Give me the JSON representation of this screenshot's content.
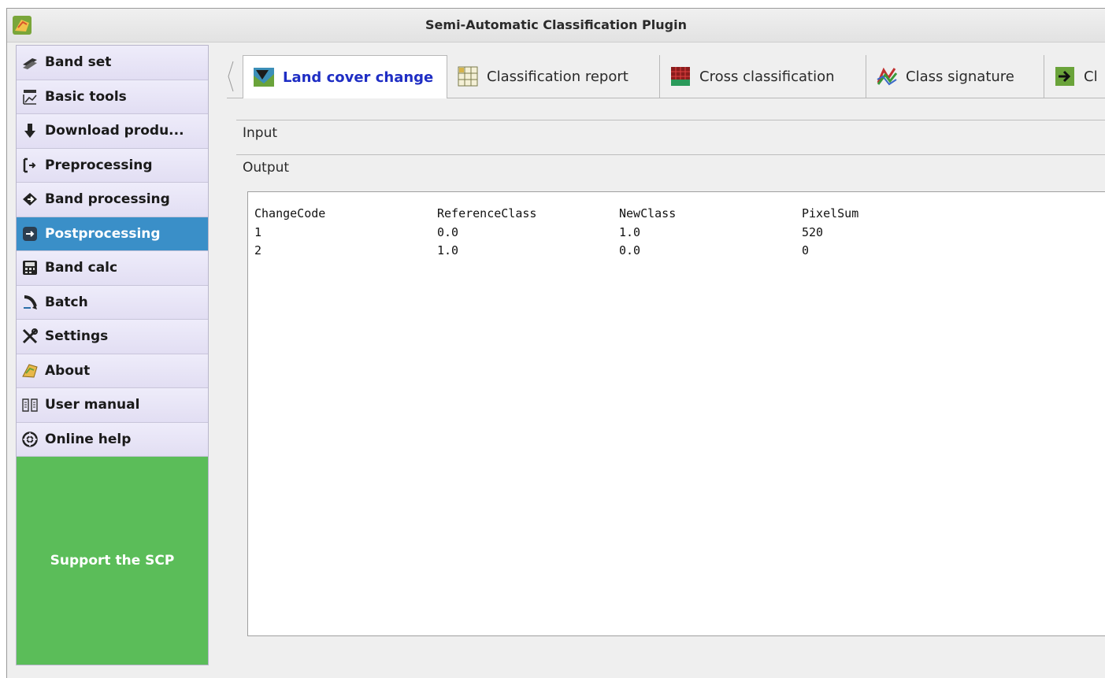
{
  "window": {
    "title": "Semi-Automatic Classification Plugin"
  },
  "sidebar": {
    "items": [
      {
        "label": "Band set",
        "icon": "band-set-icon"
      },
      {
        "label": "Basic tools",
        "icon": "basic-tools-icon"
      },
      {
        "label": "Download produ...",
        "icon": "download-icon"
      },
      {
        "label": "Preprocessing",
        "icon": "preprocessing-icon"
      },
      {
        "label": "Band processing",
        "icon": "band-processing-icon"
      },
      {
        "label": "Postprocessing",
        "icon": "postprocessing-icon"
      },
      {
        "label": "Band calc",
        "icon": "calculator-icon"
      },
      {
        "label": "Batch",
        "icon": "batch-icon"
      },
      {
        "label": "Settings",
        "icon": "settings-icon"
      },
      {
        "label": "About",
        "icon": "about-icon"
      },
      {
        "label": "User manual",
        "icon": "manual-icon"
      },
      {
        "label": "Online help",
        "icon": "help-icon"
      }
    ],
    "active": "Postprocessing",
    "support_label": "Support the SCP"
  },
  "tabs": [
    {
      "label": "Land cover change",
      "icon": "land-cover-change-icon"
    },
    {
      "label": "Classification report",
      "icon": "classification-report-icon"
    },
    {
      "label": "Cross classification",
      "icon": "cross-classification-icon"
    },
    {
      "label": "Class signature",
      "icon": "class-signature-icon"
    },
    {
      "label": "Cl",
      "icon": "class-to-vector-icon"
    }
  ],
  "sections": {
    "input": "Input",
    "output": "Output"
  },
  "output_table": {
    "headers": [
      "ChangeCode",
      "ReferenceClass",
      "NewClass",
      "PixelSum"
    ],
    "rows": [
      [
        "1",
        "0.0",
        "1.0",
        "520"
      ],
      [
        "2",
        "1.0",
        "0.0",
        "0"
      ]
    ]
  },
  "colors": {
    "active_item": "#3a8fc8",
    "active_tab_text": "#1f2ec4",
    "support_bg": "#5bbd59",
    "sidebar_bg": "#e9e6f7"
  }
}
